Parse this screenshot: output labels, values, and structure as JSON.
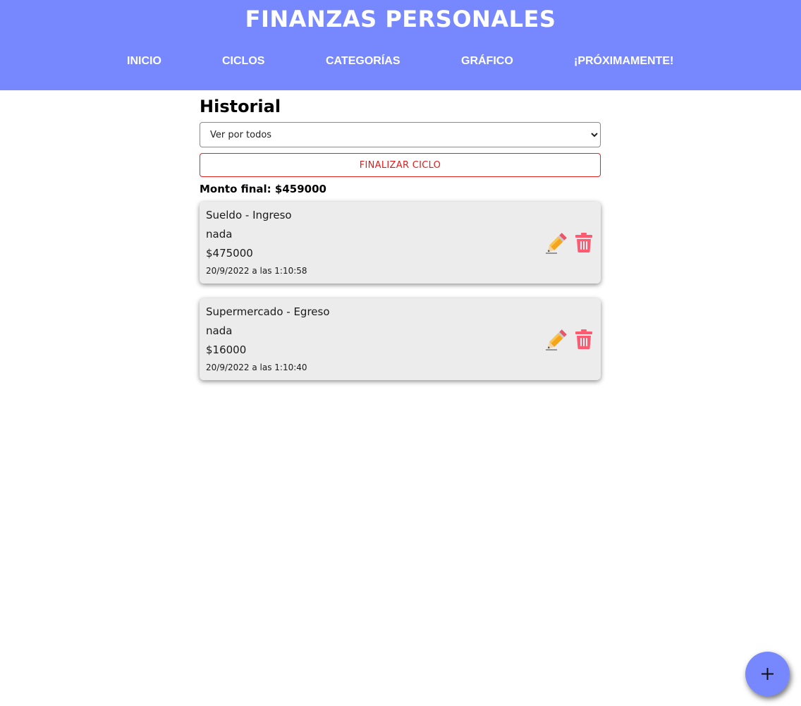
{
  "app": {
    "title": "FINANZAS PERSONALES",
    "nav": [
      {
        "label": "INICIO"
      },
      {
        "label": "CICLOS"
      },
      {
        "label": "CATEGORÍAS"
      },
      {
        "label": "GRÁFICO"
      },
      {
        "label": "¡PRÓXIMAMENTE!"
      }
    ],
    "colors": {
      "primary": "#7788ff",
      "danger": "#e01b1b",
      "card_bg": "#ececec",
      "delete_icon": "#ff5a70"
    }
  },
  "history": {
    "title": "Historial",
    "filter": {
      "selected": "Ver por todos",
      "options": [
        "Ver por todos"
      ]
    },
    "finish_button": "FINALIZAR CICLO",
    "final_amount": "Monto final: $459000",
    "entries": [
      {
        "title": "Sueldo - Ingreso",
        "description": "nada",
        "amount": "$475000",
        "date": "20/9/2022 a las 1:10:58",
        "edit_icon": "pencil-icon",
        "delete_icon": "trash-icon"
      },
      {
        "title": "Supermercado - Egreso",
        "description": "nada",
        "amount": "$16000",
        "date": "20/9/2022 a las 1:10:40",
        "edit_icon": "pencil-icon",
        "delete_icon": "trash-icon"
      }
    ]
  },
  "fab": {
    "icon": "plus-icon"
  }
}
